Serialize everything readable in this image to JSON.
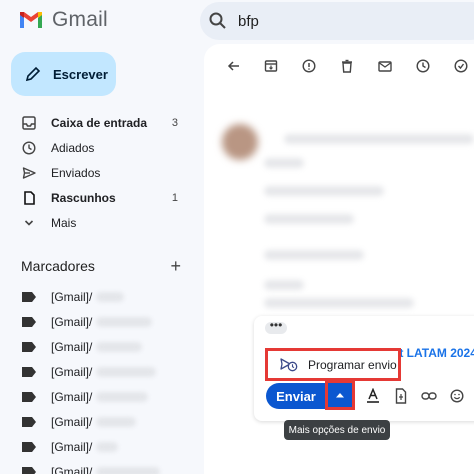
{
  "header": {
    "app_name": "Gmail",
    "search_value": "bfp"
  },
  "sidebar": {
    "compose_label": "Escrever",
    "items": [
      {
        "label": "Caixa de entrada",
        "count": "3",
        "icon": "inbox-icon",
        "bold": true
      },
      {
        "label": "Adiados",
        "count": "",
        "icon": "clock-icon",
        "bold": false
      },
      {
        "label": "Enviados",
        "count": "",
        "icon": "send-icon",
        "bold": false
      },
      {
        "label": "Rascunhos",
        "count": "1",
        "icon": "draft-icon",
        "bold": true
      },
      {
        "label": "Mais",
        "count": "",
        "icon": "chevron-down-icon",
        "bold": false
      }
    ],
    "labels_title": "Marcadores",
    "labels_add": "+",
    "labels": [
      "[Gmail]/",
      "[Gmail]/",
      "[Gmail]/",
      "[Gmail]/",
      "[Gmail]/",
      "[Gmail]/",
      "[Gmail]/",
      "[Gmail]/"
    ]
  },
  "compose": {
    "dots": "•••",
    "subject_partial": "nt LATAM 2024",
    "schedule_label": "Programar envio",
    "send_label": "Enviar",
    "tooltip": "Mais opções de envio"
  },
  "colors": {
    "compose_bg": "#c2e7ff",
    "send_bg": "#0b57d0",
    "highlight": "#e53935"
  }
}
